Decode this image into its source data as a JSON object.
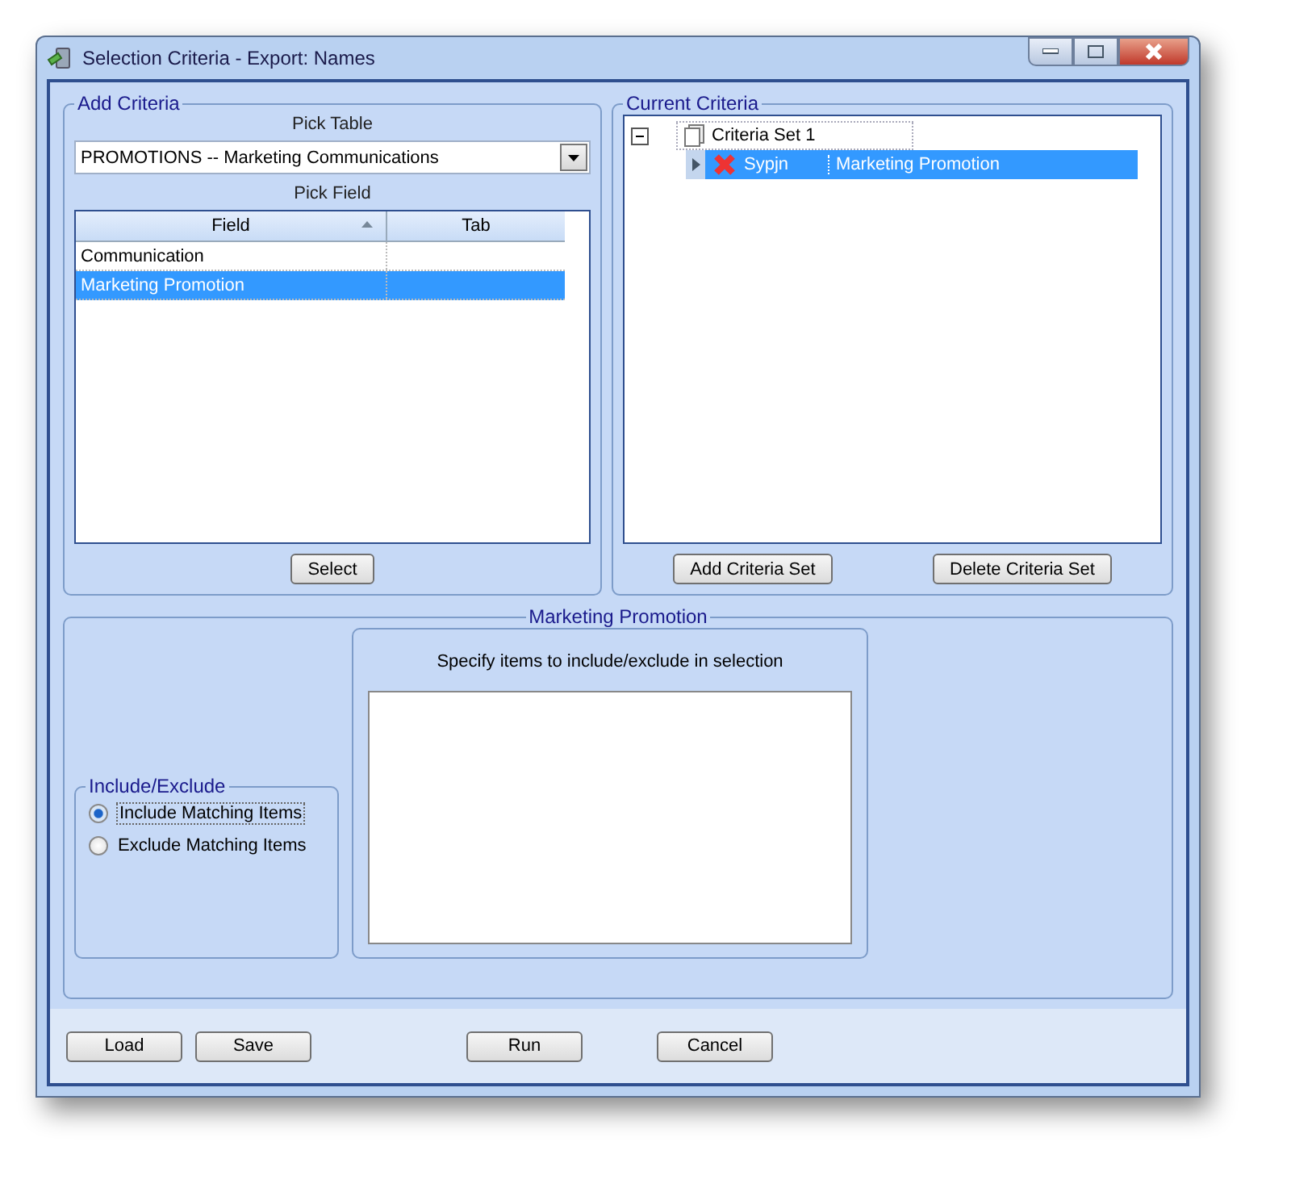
{
  "window": {
    "title": "Selection Criteria - Export: Names"
  },
  "add_criteria": {
    "title": "Add Criteria",
    "pick_table_label": "Pick Table",
    "pick_table_value": "PROMOTIONS -- Marketing Communications",
    "pick_field_label": "Pick Field",
    "columns": [
      "Field",
      "Tab"
    ],
    "rows": [
      {
        "field": "Communication",
        "selected": false
      },
      {
        "field": "Marketing Promotion",
        "selected": true
      }
    ],
    "select_button": "Select"
  },
  "current_criteria": {
    "title": "Current Criteria",
    "tree": [
      {
        "label": "Criteria Set 1",
        "expanded": true,
        "children": [
          {
            "code": "Sypjn",
            "name": "Marketing Promotion",
            "selected": true
          }
        ]
      }
    ],
    "buttons": [
      "Add Criteria Set",
      "Delete Criteria Set"
    ]
  },
  "detail": {
    "title": "Marketing Promotion",
    "include_exclude_title": "Include/Exclude",
    "options": [
      {
        "label": "Include Matching Items",
        "selected": true
      },
      {
        "label": "Exclude Matching Items",
        "selected": false
      }
    ],
    "items_label": "Specify items to include/exclude in selection"
  },
  "footer_buttons": [
    "Load",
    "Save",
    "Run",
    "Cancel"
  ]
}
